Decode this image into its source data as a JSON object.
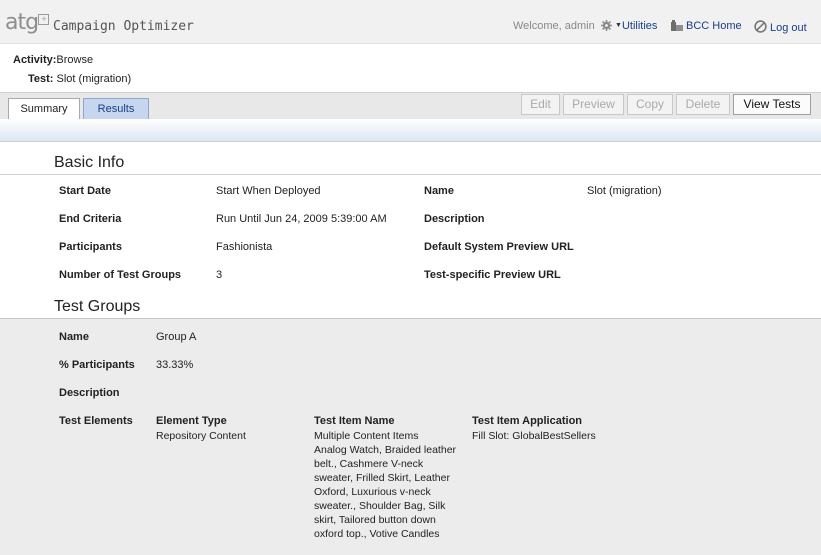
{
  "header": {
    "logo_text": "atg",
    "logo_mark": "+",
    "app_title": "Campaign Optimizer",
    "welcome": "Welcome, admin",
    "utilities_label": "Utilities",
    "bcc_home_label": "BCC Home",
    "logout_label": "Log out"
  },
  "context": {
    "activity_label": "Activity:",
    "activity_value": "Browse",
    "test_label": "Test:",
    "test_value": "Slot (migration)"
  },
  "tabs": [
    {
      "label": "Summary",
      "selected": true
    },
    {
      "label": "Results",
      "selected": false
    }
  ],
  "toolbar": {
    "edit": "Edit",
    "preview": "Preview",
    "copy": "Copy",
    "delete": "Delete",
    "view_tests": "View Tests"
  },
  "basic_info": {
    "title": "Basic Info",
    "start_date_label": "Start Date",
    "start_date_value": "Start When Deployed",
    "end_criteria_label": "End Criteria",
    "end_criteria_value": "Run Until Jun 24, 2009 5:39:00 AM",
    "participants_label": "Participants",
    "participants_value": "Fashionista",
    "num_groups_label": "Number of Test Groups",
    "num_groups_value": "3",
    "name_label": "Name",
    "name_value": "Slot (migration)",
    "description_label": "Description",
    "default_preview_label": "Default System Preview URL",
    "test_preview_label": "Test-specific Preview URL"
  },
  "test_groups": {
    "title": "Test Groups",
    "name_label": "Name",
    "name_value": "Group A",
    "participants_label": "% Participants",
    "participants_value": "33.33%",
    "description_label": "Description",
    "elements_label": "Test Elements",
    "col_element_type": "Element Type",
    "col_item_name": "Test Item Name",
    "col_item_app": "Test Item Application",
    "element_type_value": "Repository Content",
    "item_name_lines": [
      "Multiple Content Items",
      "Analog Watch, Braided leather",
      "belt., Cashmere V-neck",
      "sweater, Frilled Skirt, Leather",
      "Oxford, Luxurious v-neck",
      "sweater., Shoulder Bag, Silk",
      "skirt, Tailored button down",
      "oxford top., Votive Candles"
    ],
    "item_app_value": "Fill Slot: GlobalBestSellers"
  },
  "icons": {
    "utilities": "gear-icon",
    "bcc_home": "building-icon",
    "logout": "no-entry-icon"
  }
}
